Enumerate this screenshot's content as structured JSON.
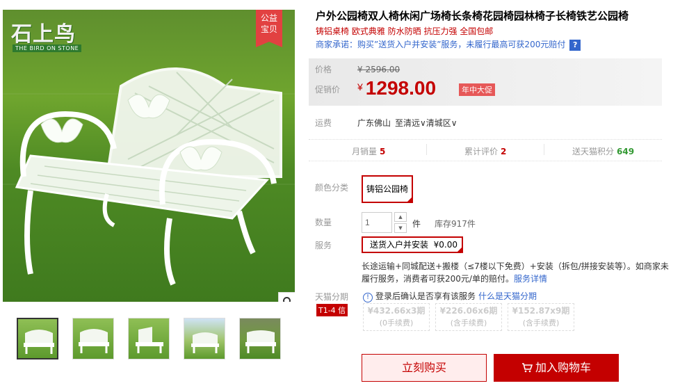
{
  "gallery": {
    "logo_text": "石上鸟",
    "logo_sub": "THE BIRD ON STONE",
    "badge_line1": "公益",
    "badge_line2": "宝贝",
    "zoom_icon": "magnifier-icon",
    "thumbnails": [
      "thumb-1",
      "thumb-2",
      "thumb-3",
      "thumb-4",
      "thumb-5"
    ]
  },
  "product": {
    "title": "户外公园椅双人椅休闲广场椅长条椅花园椅园林椅子长椅铁艺公园椅",
    "subtitle": "铸铝桌椅 欧式典雅 防水防晒 抗压力强 全国包邮",
    "promise": "商家承诺：购买”送货入户并安装”服务，未履行最高可获200元赔付",
    "help": "?"
  },
  "price": {
    "original_label": "价格",
    "original_value": "2596.00",
    "currency": "¥",
    "promo_label": "促销价",
    "promo_value": "1298.00",
    "promo_tag": "年中大促"
  },
  "shipping": {
    "label": "运费",
    "from": "广东佛山",
    "to": "至清远∨清城区∨"
  },
  "stats": {
    "monthly_sales_label": "月销量",
    "monthly_sales": "5",
    "reviews_label": "累计评价",
    "reviews": "2",
    "points_label": "送天猫积分",
    "points": "649"
  },
  "options": {
    "color_label": "颜色分类",
    "color_value": "铸铝公园椅",
    "qty_label": "数量",
    "qty_value": "1",
    "qty_unit": "件",
    "stock": "库存917件",
    "service_label": "服务",
    "service_value": "送货入户并安装  ¥0.00",
    "service_desc": "长途运输+同城配送+搬楼（≤7楼以下免费）+安装（拆包/拼接安装等）。如商家未履行服务，消费者可获200元/单的赔付。",
    "service_link": "服务详情"
  },
  "installment": {
    "label": "天猫分期",
    "badge": "T1-4 信",
    "info": "登录后确认是否享有该服务",
    "info_link": "什么是天猫分期",
    "plans": [
      {
        "amount": "¥432.66x3期",
        "fee": "(0手续费)"
      },
      {
        "amount": "¥226.06x6期",
        "fee": "(含手续费)"
      },
      {
        "amount": "¥152.87x9期",
        "fee": "(含手续费)"
      }
    ]
  },
  "actions": {
    "buy_now": "立刻购买",
    "add_to_cart": "加入购物车"
  },
  "colors": {
    "accent": "#c40000",
    "link": "#3366cc",
    "promo_tag": "#e65858"
  }
}
